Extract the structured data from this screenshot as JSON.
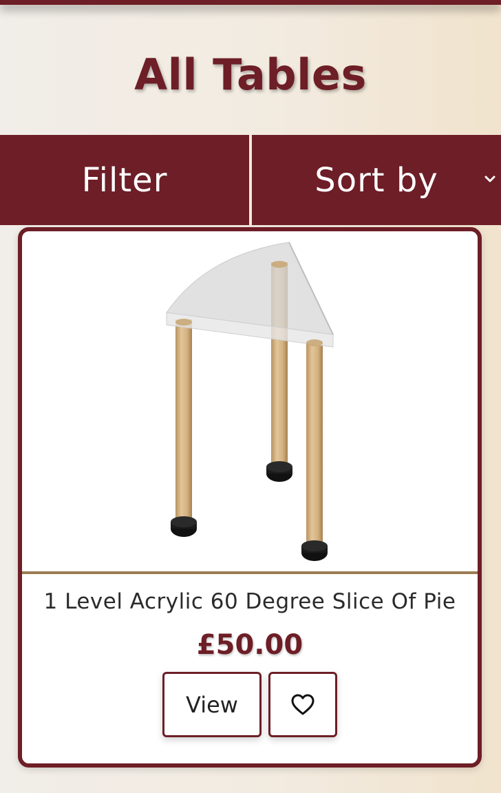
{
  "header": {
    "title": "All Tables"
  },
  "controls": {
    "filter_label": "Filter",
    "sort_label": "Sort by"
  },
  "product": {
    "name": "1 Level Acrylic 60 Degree Slice Of Pie",
    "price": "£50.00",
    "view_label": "View",
    "wishlist_icon": "heart-outline-icon"
  },
  "colors": {
    "brand": "#6d1e26",
    "divider": "#9a7b52",
    "background": "#f2ebe0"
  }
}
